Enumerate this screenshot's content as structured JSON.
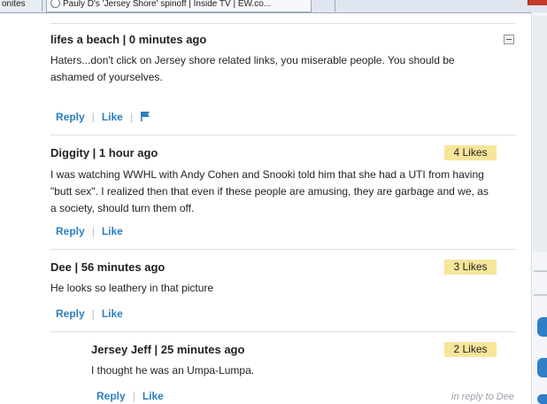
{
  "browser": {
    "left_tab_title": "onites",
    "active_tab_title": "Pauly D's 'Jersey Shore' spinoff | Inside TV | EW.co..."
  },
  "comments": [
    {
      "author_line": "lifes a beach | 0 minutes ago",
      "text": "Haters...don't click on Jersey shore related links, you miserable people. You should be ashamed of yourselves.",
      "reply_label": "Reply",
      "like_label": "Like",
      "likes": "",
      "icons": [
        "collapse-icon",
        "flag-icon"
      ]
    },
    {
      "author_line": "Diggity | 1 hour ago",
      "text": "I was watching WWHL with Andy Cohen and Snooki told him that she had a UTI from having \"butt sex\". I realized then that even if these people are amusing, they are garbage and we, as a society, should turn them off.",
      "reply_label": "Reply",
      "like_label": "Like",
      "likes": "4 Likes"
    },
    {
      "author_line": "Dee | 56 minutes ago",
      "text": "He looks so leathery in that picture",
      "reply_label": "Reply",
      "like_label": "Like",
      "likes": "3 Likes"
    },
    {
      "author_line": "Jersey Jeff | 25 minutes ago",
      "text": "I thought he was an Umpa-Lumpa.",
      "reply_label": "Reply",
      "like_label": "Like",
      "likes": "2 Likes",
      "in_reply_to": "in reply to Dee"
    }
  ],
  "colors": {
    "link": "#2b7fc1",
    "likes_badge": "#f7e69a",
    "divider": "#dde1e6"
  }
}
